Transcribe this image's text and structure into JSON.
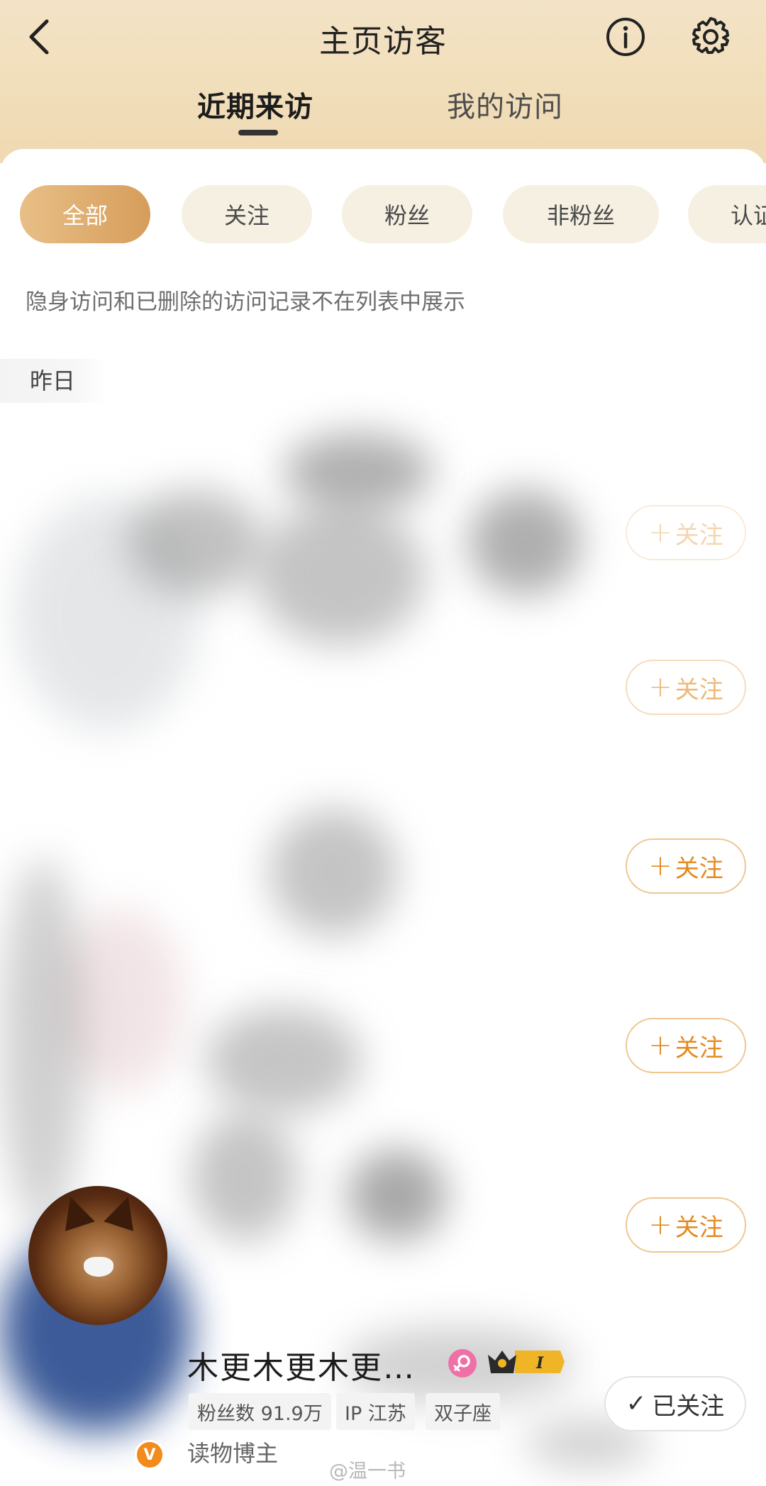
{
  "header": {
    "title": "主页访客",
    "tabs": [
      {
        "label": "近期来访",
        "active": true
      },
      {
        "label": "我的访问",
        "active": false
      }
    ]
  },
  "filters": [
    {
      "label": "全部",
      "active": true
    },
    {
      "label": "关注",
      "active": false
    },
    {
      "label": "粉丝",
      "active": false
    },
    {
      "label": "非粉丝",
      "active": false
    },
    {
      "label": "认证",
      "active": false
    }
  ],
  "notice": "隐身访问和已删除的访问记录不在列表中展示",
  "date_group": "昨日",
  "follow_buttons": [
    {
      "plus": "+",
      "label": "关注"
    },
    {
      "plus": "+",
      "label": "关注"
    },
    {
      "plus": "+",
      "label": "关注"
    },
    {
      "plus": "+",
      "label": "关注"
    },
    {
      "plus": "+",
      "label": "关注"
    }
  ],
  "last_visitor": {
    "name": "木更木更木更…",
    "verified_mark": "V",
    "vip_level": "I",
    "tags": [
      "粉丝数 91.9万",
      "IP 江苏",
      "双子座"
    ],
    "subtitle": "读物博主",
    "followed_label": "已关注",
    "followed_check": "✓"
  },
  "watermark": "@温一书",
  "colors": {
    "accent": "#d69d5b",
    "follow_text": "#e48a1f",
    "header_bg": "#f1deba"
  }
}
